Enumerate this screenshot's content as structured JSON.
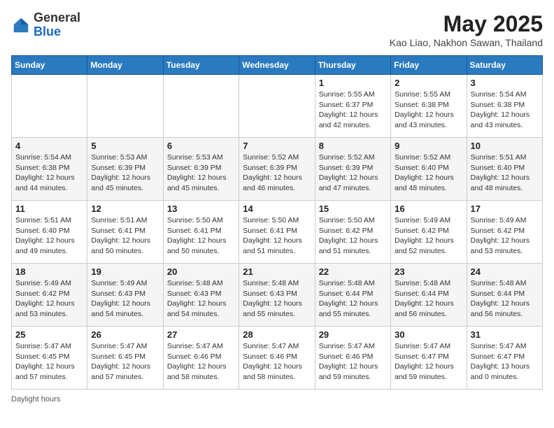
{
  "header": {
    "logo_general": "General",
    "logo_blue": "Blue",
    "month_title": "May 2025",
    "location": "Kao Liao, Nakhon Sawan, Thailand"
  },
  "days_of_week": [
    "Sunday",
    "Monday",
    "Tuesday",
    "Wednesday",
    "Thursday",
    "Friday",
    "Saturday"
  ],
  "weeks": [
    [
      {
        "day": "",
        "info": ""
      },
      {
        "day": "",
        "info": ""
      },
      {
        "day": "",
        "info": ""
      },
      {
        "day": "",
        "info": ""
      },
      {
        "day": "1",
        "info": "Sunrise: 5:55 AM\nSunset: 6:37 PM\nDaylight: 12 hours\nand 42 minutes."
      },
      {
        "day": "2",
        "info": "Sunrise: 5:55 AM\nSunset: 6:38 PM\nDaylight: 12 hours\nand 43 minutes."
      },
      {
        "day": "3",
        "info": "Sunrise: 5:54 AM\nSunset: 6:38 PM\nDaylight: 12 hours\nand 43 minutes."
      }
    ],
    [
      {
        "day": "4",
        "info": "Sunrise: 5:54 AM\nSunset: 6:38 PM\nDaylight: 12 hours\nand 44 minutes."
      },
      {
        "day": "5",
        "info": "Sunrise: 5:53 AM\nSunset: 6:39 PM\nDaylight: 12 hours\nand 45 minutes."
      },
      {
        "day": "6",
        "info": "Sunrise: 5:53 AM\nSunset: 6:39 PM\nDaylight: 12 hours\nand 45 minutes."
      },
      {
        "day": "7",
        "info": "Sunrise: 5:52 AM\nSunset: 6:39 PM\nDaylight: 12 hours\nand 46 minutes."
      },
      {
        "day": "8",
        "info": "Sunrise: 5:52 AM\nSunset: 6:39 PM\nDaylight: 12 hours\nand 47 minutes."
      },
      {
        "day": "9",
        "info": "Sunrise: 5:52 AM\nSunset: 6:40 PM\nDaylight: 12 hours\nand 48 minutes."
      },
      {
        "day": "10",
        "info": "Sunrise: 5:51 AM\nSunset: 6:40 PM\nDaylight: 12 hours\nand 48 minutes."
      }
    ],
    [
      {
        "day": "11",
        "info": "Sunrise: 5:51 AM\nSunset: 6:40 PM\nDaylight: 12 hours\nand 49 minutes."
      },
      {
        "day": "12",
        "info": "Sunrise: 5:51 AM\nSunset: 6:41 PM\nDaylight: 12 hours\nand 50 minutes."
      },
      {
        "day": "13",
        "info": "Sunrise: 5:50 AM\nSunset: 6:41 PM\nDaylight: 12 hours\nand 50 minutes."
      },
      {
        "day": "14",
        "info": "Sunrise: 5:50 AM\nSunset: 6:41 PM\nDaylight: 12 hours\nand 51 minutes."
      },
      {
        "day": "15",
        "info": "Sunrise: 5:50 AM\nSunset: 6:42 PM\nDaylight: 12 hours\nand 51 minutes."
      },
      {
        "day": "16",
        "info": "Sunrise: 5:49 AM\nSunset: 6:42 PM\nDaylight: 12 hours\nand 52 minutes."
      },
      {
        "day": "17",
        "info": "Sunrise: 5:49 AM\nSunset: 6:42 PM\nDaylight: 12 hours\nand 53 minutes."
      }
    ],
    [
      {
        "day": "18",
        "info": "Sunrise: 5:49 AM\nSunset: 6:42 PM\nDaylight: 12 hours\nand 53 minutes."
      },
      {
        "day": "19",
        "info": "Sunrise: 5:49 AM\nSunset: 6:43 PM\nDaylight: 12 hours\nand 54 minutes."
      },
      {
        "day": "20",
        "info": "Sunrise: 5:48 AM\nSunset: 6:43 PM\nDaylight: 12 hours\nand 54 minutes."
      },
      {
        "day": "21",
        "info": "Sunrise: 5:48 AM\nSunset: 6:43 PM\nDaylight: 12 hours\nand 55 minutes."
      },
      {
        "day": "22",
        "info": "Sunrise: 5:48 AM\nSunset: 6:44 PM\nDaylight: 12 hours\nand 55 minutes."
      },
      {
        "day": "23",
        "info": "Sunrise: 5:48 AM\nSunset: 6:44 PM\nDaylight: 12 hours\nand 56 minutes."
      },
      {
        "day": "24",
        "info": "Sunrise: 5:48 AM\nSunset: 6:44 PM\nDaylight: 12 hours\nand 56 minutes."
      }
    ],
    [
      {
        "day": "25",
        "info": "Sunrise: 5:47 AM\nSunset: 6:45 PM\nDaylight: 12 hours\nand 57 minutes."
      },
      {
        "day": "26",
        "info": "Sunrise: 5:47 AM\nSunset: 6:45 PM\nDaylight: 12 hours\nand 57 minutes."
      },
      {
        "day": "27",
        "info": "Sunrise: 5:47 AM\nSunset: 6:46 PM\nDaylight: 12 hours\nand 58 minutes."
      },
      {
        "day": "28",
        "info": "Sunrise: 5:47 AM\nSunset: 6:46 PM\nDaylight: 12 hours\nand 58 minutes."
      },
      {
        "day": "29",
        "info": "Sunrise: 5:47 AM\nSunset: 6:46 PM\nDaylight: 12 hours\nand 59 minutes."
      },
      {
        "day": "30",
        "info": "Sunrise: 5:47 AM\nSunset: 6:47 PM\nDaylight: 12 hours\nand 59 minutes."
      },
      {
        "day": "31",
        "info": "Sunrise: 5:47 AM\nSunset: 6:47 PM\nDaylight: 13 hours\nand 0 minutes."
      }
    ]
  ],
  "footer": {
    "note": "Daylight hours"
  }
}
